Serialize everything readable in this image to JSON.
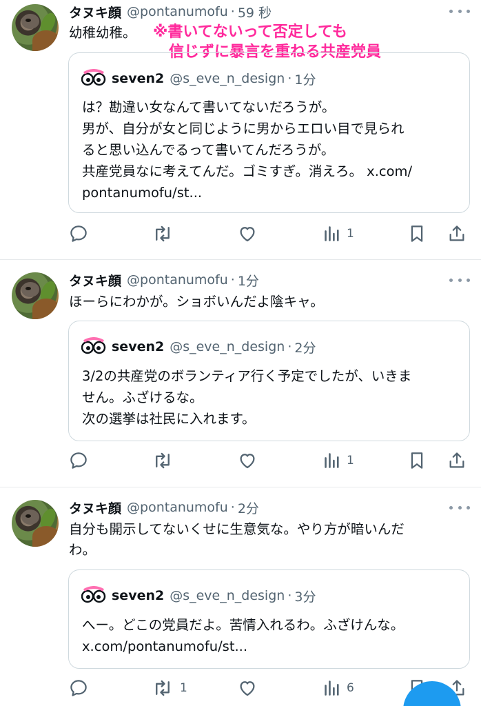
{
  "annotation": {
    "line1": "※書いてないって否定しても",
    "line2": "信じずに暴言を重ねる共産党員",
    "color": "#ff2a9c"
  },
  "tweets": [
    {
      "author": "タヌキ顔",
      "handle": "@pontanumofu",
      "time": "59 秒",
      "text": "幼稚幼稚。",
      "quote": {
        "author": "seven2",
        "handle": "@s_eve_n_design",
        "time": "1分",
        "lines": [
          "は？勘違い女なんて書いてないだろうが。",
          "男が、自分が女と同じように男からエロい目で見られ",
          "ると思い込んでるって書いてんだろうが。",
          "共産党員なに考えてんだ。ゴミすぎ。消えろ。 x.com/",
          "pontanumofu/st..."
        ]
      },
      "actions": {
        "reply": "",
        "retweet": "",
        "like": "",
        "views": "1"
      }
    },
    {
      "author": "タヌキ顔",
      "handle": "@pontanumofu",
      "time": "1分",
      "text": "ほーらにわかが。ショボいんだよ陰キャ。",
      "quote": {
        "author": "seven2",
        "handle": "@s_eve_n_design",
        "time": "2分",
        "lines": [
          "3/2の共産党のボランティア行く予定でしたが、いきま",
          "せん。ふざけるな。",
          "次の選挙は社民に入れます。"
        ]
      },
      "actions": {
        "reply": "",
        "retweet": "",
        "like": "",
        "views": "1"
      }
    },
    {
      "author": "タヌキ顔",
      "handle": "@pontanumofu",
      "time": "2分",
      "text_lines": [
        "自分も開示してないくせに生意気な。やり方が暗いんだ",
        "わ。"
      ],
      "quote": {
        "author": "seven2",
        "handle": "@s_eve_n_design",
        "time": "3分",
        "lines": [
          "へー。どこの党員だよ。苦情入れるわ。ふざけんな。",
          "x.com/pontanumofu/st..."
        ]
      },
      "actions": {
        "reply": "",
        "retweet": "1",
        "like": "",
        "views": "6"
      }
    }
  ],
  "separator": "·",
  "colors": {
    "text": "#0f1419",
    "secondary": "#536471",
    "border": "#cfd9de",
    "accent": "#1d9bf0"
  }
}
